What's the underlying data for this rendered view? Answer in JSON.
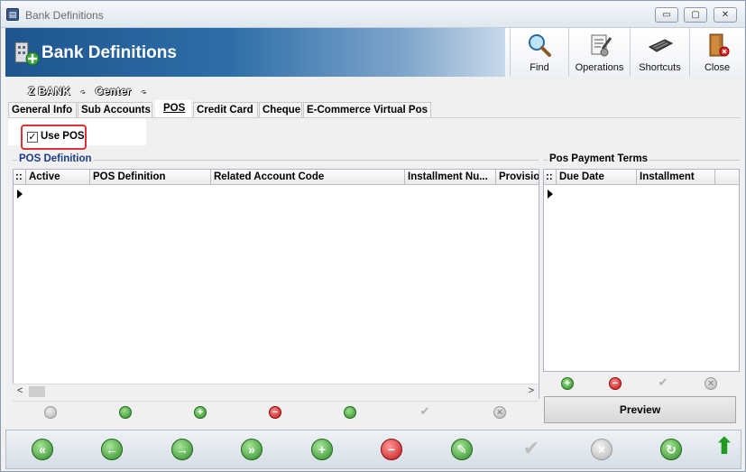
{
  "window": {
    "title": "Bank Definitions",
    "minimize_glyph": "▭",
    "maximize_glyph": "▢",
    "close_glyph": "✕"
  },
  "header": {
    "title": "Bank Definitions",
    "tools": [
      {
        "label": "Find",
        "icon": "magnifier-icon"
      },
      {
        "label": "Operations",
        "icon": "operations-icon"
      },
      {
        "label": "Shortcuts",
        "icon": "keyboard-icon"
      },
      {
        "label": "Close",
        "icon": "exit-door-icon"
      }
    ]
  },
  "record": {
    "bank_name": "Z BANK",
    "separator1": "-",
    "branch": "Center",
    "separator2": "-"
  },
  "tabs": [
    {
      "label": "General Info"
    },
    {
      "label": "Sub Accounts"
    },
    {
      "label": "POS",
      "active": true
    },
    {
      "label": "Credit Card"
    },
    {
      "label": "Cheque"
    },
    {
      "label": "E-Commerce Virtual Pos"
    }
  ],
  "use_pos": {
    "label": "Use POS",
    "checked": true,
    "check_glyph": "✓"
  },
  "pos_definition": {
    "title": "POS Definition",
    "columns": [
      "::",
      "Active",
      "POS Definition",
      "Related Account Code",
      "Installment Nu...",
      "Provisio"
    ],
    "row_indicator": "▶"
  },
  "pos_payment_terms": {
    "title": "Pos Payment Terms",
    "columns": [
      "::",
      "Due Date",
      "Installment"
    ],
    "preview_label": "Preview"
  },
  "scroll": {
    "left_arrow": "<",
    "right_arrow": ">"
  },
  "colors": {
    "banner_start": "#1e5590",
    "highlight_border": "#e0303a",
    "green_button": "#2f8b28",
    "red_button": "#c21414"
  }
}
